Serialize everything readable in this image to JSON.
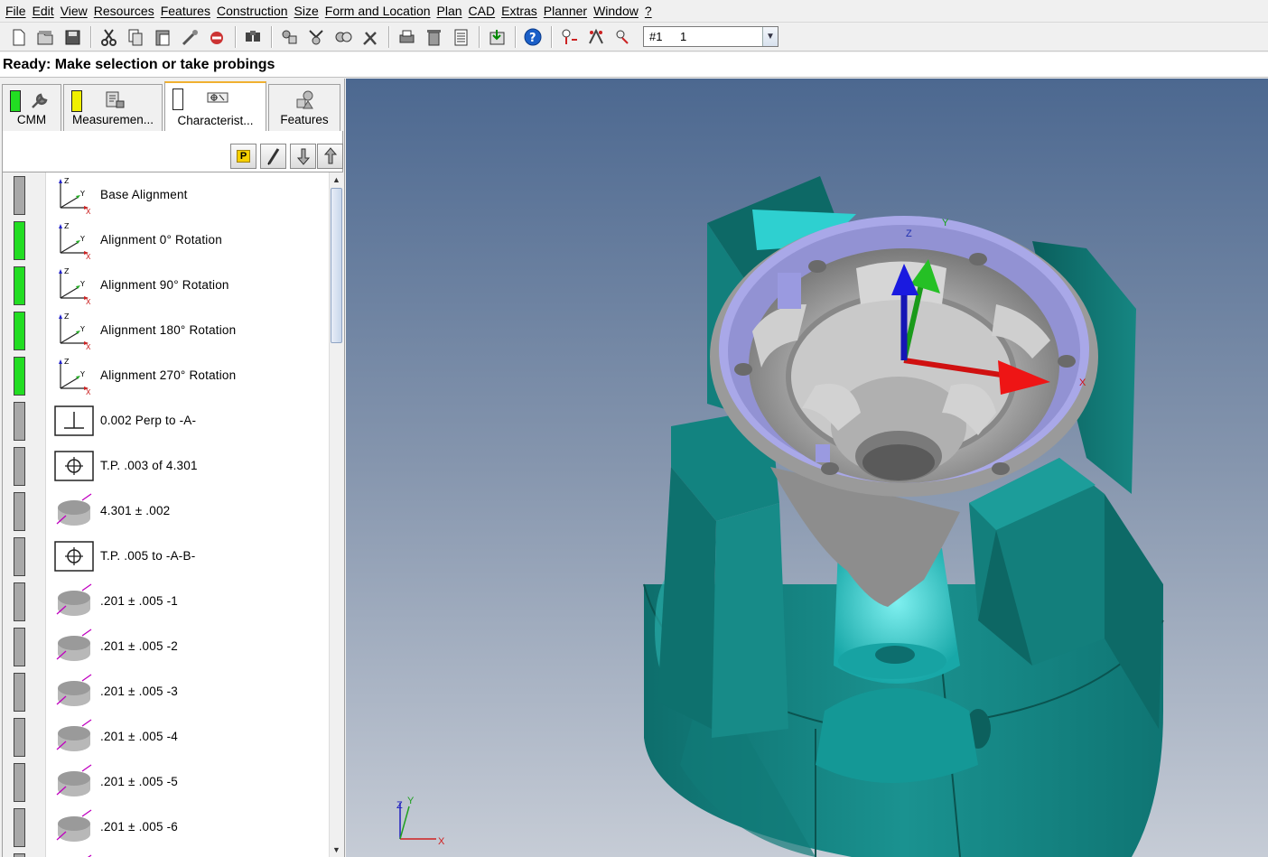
{
  "menu": [
    "File",
    "Edit",
    "View",
    "Resources",
    "Features",
    "Construction",
    "Size",
    "Form and Location",
    "Plan",
    "CAD",
    "Extras",
    "Planner",
    "Window",
    "?"
  ],
  "toolbar": {
    "icons": [
      "new-icon",
      "open-icon",
      "save-icon",
      "cut-icon",
      "copy-icon",
      "paste-icon",
      "probe-icon",
      "undo-icon",
      "find-icon",
      "feature-icon",
      "measure-icon",
      "construct-icon",
      "tools-icon",
      "print-icon",
      "delete-icon",
      "report-icon",
      "export-icon",
      "help-icon",
      "stylus-icon",
      "axis-icon",
      "probe-path-icon"
    ],
    "combo_prefix": "#1",
    "combo_value": "1"
  },
  "status": "Ready: Make selection or take probings",
  "tabs": [
    {
      "label": "CMM",
      "color": "#22dd22"
    },
    {
      "label": "Measuremen...",
      "color": "#f0f000"
    },
    {
      "label": "Characterist...",
      "color": "#ffffff"
    },
    {
      "label": "Features",
      "color": ""
    }
  ],
  "subtoolbar": {
    "p_label": "P"
  },
  "list": [
    {
      "label": "Base Alignment",
      "icon": "alignment-icon",
      "status": "#a8a8a8"
    },
    {
      "label": "Alignment 0° Rotation",
      "icon": "alignment-icon",
      "status": "#22dd22"
    },
    {
      "label": "Alignment 90° Rotation",
      "icon": "alignment-icon",
      "status": "#22dd22"
    },
    {
      "label": "Alignment 180° Rotation",
      "icon": "alignment-icon",
      "status": "#22dd22"
    },
    {
      "label": "Alignment 270° Rotation",
      "icon": "alignment-icon",
      "status": "#22dd22"
    },
    {
      "label": "0.002 Perp to -A-",
      "icon": "perpendicularity-icon",
      "status": "#a8a8a8"
    },
    {
      "label": "T.P. .003 of 4.301",
      "icon": "true-position-icon",
      "status": "#a8a8a8"
    },
    {
      "label": "4.301 ± .002",
      "icon": "cylinder-icon",
      "status": "#a8a8a8"
    },
    {
      "label": "T.P. .005 to -A-B-",
      "icon": "true-position-icon",
      "status": "#a8a8a8"
    },
    {
      "label": ".201 ± .005  -1",
      "icon": "cylinder-icon",
      "status": "#a8a8a8"
    },
    {
      "label": ".201 ± .005  -2",
      "icon": "cylinder-icon",
      "status": "#a8a8a8"
    },
    {
      "label": ".201 ± .005  -3",
      "icon": "cylinder-icon",
      "status": "#a8a8a8"
    },
    {
      "label": ".201 ± .005  -4",
      "icon": "cylinder-icon",
      "status": "#a8a8a8"
    },
    {
      "label": ".201 ± .005  -5",
      "icon": "cylinder-icon",
      "status": "#a8a8a8"
    },
    {
      "label": ".201 ± .005  -6",
      "icon": "cylinder-icon",
      "status": "#a8a8a8"
    },
    {
      "label": "",
      "icon": "cylinder-icon",
      "status": "#a8a8a8"
    }
  ],
  "axis_labels": {
    "x": "X",
    "y": "Y",
    "z": "Z"
  },
  "colors": {
    "fixture": "#1a8f8c",
    "part": "#b8b8b8",
    "bore": "#a9a8e8"
  }
}
